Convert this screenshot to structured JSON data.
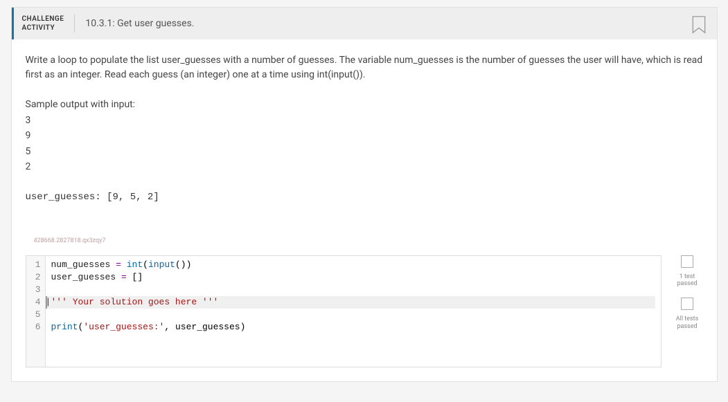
{
  "header": {
    "label_line1": "CHALLENGE",
    "label_line2": "ACTIVITY",
    "title": "10.3.1: Get user guesses."
  },
  "description": "Write a loop to populate the list user_guesses with a number of guesses. The variable num_guesses is the number of guesses the user will have, which is read first as an integer. Read each guess (an integer) one at a time using int(input()).",
  "sample": {
    "label": "Sample output with input:",
    "values": [
      "3",
      "9",
      "5",
      "2"
    ],
    "output": "user_guesses: [9, 5, 2]"
  },
  "hash": "428668.2827818.qx3zqy7",
  "code": {
    "lines": [
      "1",
      "2",
      "3",
      "4",
      "5",
      "6"
    ],
    "l1_a": "num_guesses ",
    "l1_b": "=",
    "l1_c": " ",
    "l1_d": "int",
    "l1_e": "(",
    "l1_f": "input",
    "l1_g": "())",
    "l2_a": "user_guesses ",
    "l2_b": "=",
    "l2_c": " []",
    "l4_a": "''' Your solution goes here '''",
    "l6_a": "print",
    "l6_b": "(",
    "l6_c": "'user_guesses:'",
    "l6_d": ", user_guesses)"
  },
  "tests": {
    "t1_line1": "1 test",
    "t1_line2": "passed",
    "t2_line1": "All tests",
    "t2_line2": "passed"
  }
}
